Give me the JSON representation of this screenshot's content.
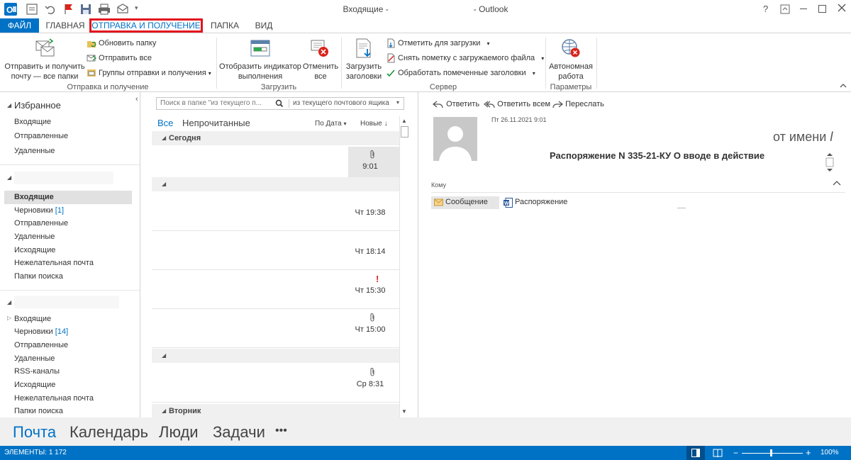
{
  "window": {
    "title_left": "Входящие -",
    "title_right": "- Outlook",
    "help": "?"
  },
  "tabs": {
    "file": "ФАЙЛ",
    "home": "ГЛАВНАЯ",
    "send_receive": "ОТПРАВКА И ПОЛУЧЕНИЕ",
    "folder": "ПАПКА",
    "view": "ВИД"
  },
  "ribbon": {
    "send_receive_all_line1": "Отправить и получить",
    "send_receive_all_line2": "почту — все папки",
    "update_folder": "Обновить папку",
    "send_all": "Отправить все",
    "send_receive_groups": "Группы отправки и получения",
    "group_send_receive": "Отправка и получение",
    "show_progress_line1": "Отобразить индикатор",
    "show_progress_line2": "выполнения",
    "cancel_all_line1": "Отменить",
    "cancel_all_line2": "все",
    "group_download": "Загрузить",
    "download_headers_line1": "Загрузить",
    "download_headers_line2": "заголовки",
    "mark_to_download": "Отметить для загрузки",
    "unmark_to_download": "Снять пометку с загружаемого файла",
    "process_marked_headers": "Обработать помеченные заголовки",
    "group_server": "Сервер",
    "work_offline_line1": "Автономная",
    "work_offline_line2": "работа",
    "group_preferences": "Параметры"
  },
  "nav": {
    "favorites": "Избранное",
    "fav_items": [
      "Входящие",
      "Отправленные",
      "Удаленные"
    ],
    "account1_items": [
      {
        "label": "Входящие",
        "count": ""
      },
      {
        "label": "Черновики",
        "count": "[1]"
      },
      {
        "label": "Отправленные",
        "count": ""
      },
      {
        "label": "Удаленные",
        "count": ""
      },
      {
        "label": "Исходящие",
        "count": ""
      },
      {
        "label": "Нежелательная почта",
        "count": ""
      },
      {
        "label": "Папки поиска",
        "count": ""
      }
    ],
    "account2_items": [
      {
        "label": "Входящие",
        "count": ""
      },
      {
        "label": "Черновики",
        "count": "[14]"
      },
      {
        "label": "Отправленные",
        "count": ""
      },
      {
        "label": "Удаленные",
        "count": ""
      },
      {
        "label": "RSS-каналы",
        "count": ""
      },
      {
        "label": "Исходящие",
        "count": ""
      },
      {
        "label": "Нежелательная почта",
        "count": ""
      },
      {
        "label": "Папки поиска",
        "count": ""
      }
    ]
  },
  "list": {
    "search_placeholder": "Поиск в папке \"из текущего п...",
    "search_scope": "из текущего почтового ящика",
    "filter_all": "Все",
    "filter_unread": "Непрочитанные",
    "sort_by": "По Дата",
    "sort_order": "Новые",
    "group_today": "Сегодня",
    "group_tuesday": "Вторник",
    "messages": [
      {
        "time": "9:01"
      },
      {
        "time": "Чт 19:38"
      },
      {
        "time": "Чт 18:14"
      },
      {
        "time": "Чт 15:30",
        "flag": "!"
      },
      {
        "time": "Чт 15:00"
      },
      {
        "time": "Ср 8:31"
      }
    ]
  },
  "reader": {
    "reply": "Ответить",
    "reply_all": "Ответить всем",
    "forward": "Переслать",
    "date": "Пт 26.11.2021 9:01",
    "on_behalf": "от имени",
    "subject": "Распоряжение N 335-21-КУ О вводе в действие",
    "to_label": "Кому",
    "att_message": "Сообщение",
    "att_file": "Распоряжение"
  },
  "bottomnav": {
    "mail": "Почта",
    "calendar": "Календарь",
    "people": "Люди",
    "tasks": "Задачи",
    "more": "•••"
  },
  "status": {
    "items": "ЭЛЕМЕНТЫ: 1 172",
    "zoom": "100%"
  },
  "colors": {
    "accent": "#0072c6",
    "highlight_border": "#e2141e"
  }
}
